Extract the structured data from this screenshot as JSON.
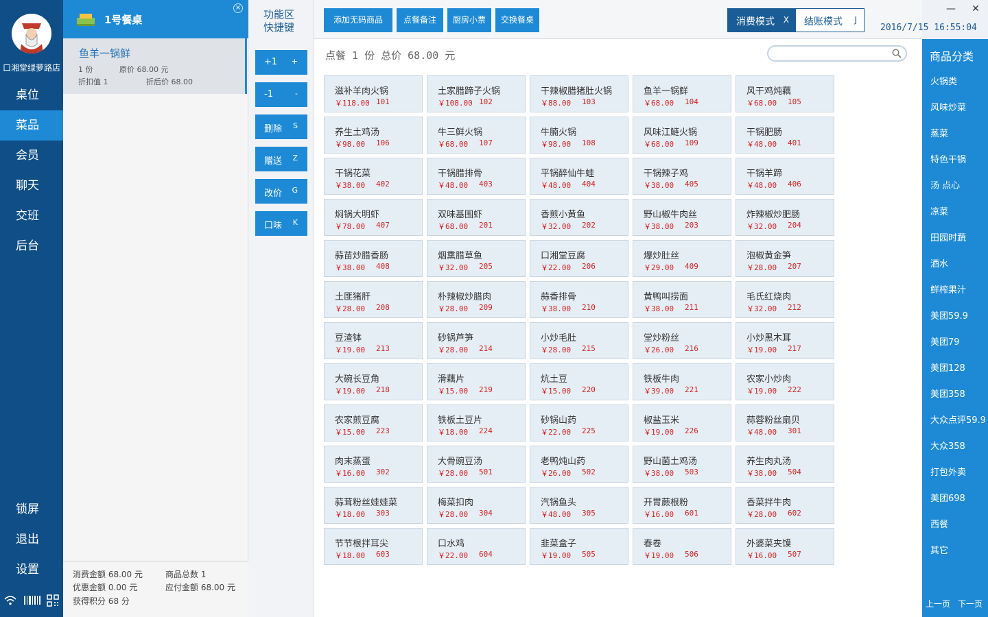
{
  "store_name": "口湘堂绿萝路店",
  "nav": [
    {
      "label": "桌位",
      "active": false
    },
    {
      "label": "菜品",
      "active": true
    },
    {
      "label": "会员",
      "active": false
    },
    {
      "label": "聊天",
      "active": false
    },
    {
      "label": "交班",
      "active": false
    },
    {
      "label": "后台",
      "active": false
    }
  ],
  "nav_bottom": [
    {
      "label": "锁屏"
    },
    {
      "label": "退出"
    },
    {
      "label": "设置"
    }
  ],
  "table": {
    "title": "1号餐桌",
    "close_icon": "close-icon"
  },
  "order_item": {
    "name": "鱼羊一锅鲜",
    "qty": "1 份",
    "original_price": "原价 68.00 元",
    "discount": "折扣值 1",
    "discounted_price": "折后价 68.00"
  },
  "summary": {
    "consume_amount": "消费金额 68.00 元",
    "goods_total": "商品总数 1",
    "discount_amount": "优惠金额 0.00 元",
    "payable": "应付金额 68.00 元",
    "points": "获得积分 68 分"
  },
  "func": {
    "title_line1": "功能区",
    "title_line2": "快捷键",
    "buttons": [
      {
        "label": "+1",
        "key": "+"
      },
      {
        "label": "-1",
        "key": "-"
      },
      {
        "label": "删除",
        "key": "S"
      },
      {
        "label": "赠送",
        "key": "Z"
      },
      {
        "label": "改价",
        "key": "G"
      },
      {
        "label": "口味",
        "key": "K"
      }
    ]
  },
  "toolbar": {
    "buttons": [
      "添加无码商品",
      "点餐备注",
      "厨房小票",
      "交换餐桌"
    ],
    "mode_consume": "消费模式",
    "mode_consume_key": "X",
    "mode_checkout": "结账模式",
    "mode_checkout_key": "J",
    "datetime": "2016/7/15 16:55:04",
    "minimize": "—",
    "close": "✕"
  },
  "order_summary": "点餐 1 份 总价 68.00 元",
  "search": {
    "placeholder": "",
    "value": ""
  },
  "products": [
    {
      "name": "滋补羊肉火锅",
      "price": "￥118.00",
      "code": "101"
    },
    {
      "name": "土家腊蹄子火锅",
      "price": "￥108.00",
      "code": "102"
    },
    {
      "name": "干辣椒腊猪肚火锅",
      "price": "￥88.00",
      "code": "103"
    },
    {
      "name": "鱼羊一锅鲜",
      "price": "￥68.00",
      "code": "104"
    },
    {
      "name": "风干鸡炖藕",
      "price": "￥68.00",
      "code": "105"
    },
    {
      "name": "养生土鸡汤",
      "price": "￥98.00",
      "code": "106"
    },
    {
      "name": "牛三鲜火锅",
      "price": "￥68.00",
      "code": "107"
    },
    {
      "name": "牛腩火锅",
      "price": "￥98.00",
      "code": "108"
    },
    {
      "name": "风味江鲢火锅",
      "price": "￥68.00",
      "code": "109"
    },
    {
      "name": "干锅肥肠",
      "price": "￥48.00",
      "code": "401"
    },
    {
      "name": "干锅花菜",
      "price": "￥38.00",
      "code": "402"
    },
    {
      "name": "干锅腊排骨",
      "price": "￥48.00",
      "code": "403"
    },
    {
      "name": "平锅醉仙牛蛙",
      "price": "￥48.00",
      "code": "404"
    },
    {
      "name": "干锅辣子鸡",
      "price": "￥38.00",
      "code": "405"
    },
    {
      "name": "干锅羊蹄",
      "price": "￥48.00",
      "code": "406"
    },
    {
      "name": "焖锅大明虾",
      "price": "￥78.00",
      "code": "407"
    },
    {
      "name": "双味基围虾",
      "price": "￥68.00",
      "code": "201"
    },
    {
      "name": "香煎小黄鱼",
      "price": "￥32.00",
      "code": "202"
    },
    {
      "name": "野山椒牛肉丝",
      "price": "￥38.00",
      "code": "203"
    },
    {
      "name": "炸辣椒炒肥肠",
      "price": "￥32.00",
      "code": "204"
    },
    {
      "name": "蒜苗炒腊香肠",
      "price": "￥38.00",
      "code": "408"
    },
    {
      "name": "烟熏腊草鱼",
      "price": "￥32.00",
      "code": "205"
    },
    {
      "name": "口湘堂豆腐",
      "price": "￥22.00",
      "code": "206"
    },
    {
      "name": "爆炒肚丝",
      "price": "￥29.00",
      "code": "409"
    },
    {
      "name": "泡椒黄金笋",
      "price": "￥28.00",
      "code": "207"
    },
    {
      "name": "土匪猪肝",
      "price": "￥28.00",
      "code": "208"
    },
    {
      "name": "朴辣椒炒腊肉",
      "price": "￥28.00",
      "code": "209"
    },
    {
      "name": "蒜香排骨",
      "price": "￥38.00",
      "code": "210"
    },
    {
      "name": "黄鸭叫捞面",
      "price": "￥38.00",
      "code": "211"
    },
    {
      "name": "毛氏红烧肉",
      "price": "￥32.00",
      "code": "212"
    },
    {
      "name": "豆渣钵",
      "price": "￥19.00",
      "code": "213"
    },
    {
      "name": "砂锅芦笋",
      "price": "￥28.00",
      "code": "214"
    },
    {
      "name": "小炒毛肚",
      "price": "￥28.00",
      "code": "215"
    },
    {
      "name": "堂炒粉丝",
      "price": "￥26.00",
      "code": "216"
    },
    {
      "name": "小炒黑木耳",
      "price": "￥19.00",
      "code": "217"
    },
    {
      "name": "大碗长豆角",
      "price": "￥19.00",
      "code": "218"
    },
    {
      "name": "滑藕片",
      "price": "￥15.00",
      "code": "219"
    },
    {
      "name": "炕土豆",
      "price": "￥15.00",
      "code": "220"
    },
    {
      "name": "铁板牛肉",
      "price": "￥39.00",
      "code": "221"
    },
    {
      "name": "农家小炒肉",
      "price": "￥19.00",
      "code": "222"
    },
    {
      "name": "农家煎豆腐",
      "price": "￥15.00",
      "code": "223"
    },
    {
      "name": "铁板土豆片",
      "price": "￥18.00",
      "code": "224"
    },
    {
      "name": "砂锅山药",
      "price": "￥22.00",
      "code": "225"
    },
    {
      "name": "椒盐玉米",
      "price": "￥19.00",
      "code": "226"
    },
    {
      "name": "蒜蓉粉丝扇贝",
      "price": "￥48.00",
      "code": "301"
    },
    {
      "name": "肉末蒸蛋",
      "price": "￥16.00",
      "code": "302"
    },
    {
      "name": "大骨豌豆汤",
      "price": "￥28.00",
      "code": "501"
    },
    {
      "name": "老鸭炖山药",
      "price": "￥26.00",
      "code": "502"
    },
    {
      "name": "野山菌土鸡汤",
      "price": "￥38.00",
      "code": "503"
    },
    {
      "name": "养生肉丸汤",
      "price": "￥38.00",
      "code": "504"
    },
    {
      "name": "蒜茸粉丝娃娃菜",
      "price": "￥18.00",
      "code": "303"
    },
    {
      "name": "梅菜扣肉",
      "price": "￥28.00",
      "code": "304"
    },
    {
      "name": "汽锅鱼头",
      "price": "￥48.00",
      "code": "305"
    },
    {
      "name": "开胃蕨根粉",
      "price": "￥16.00",
      "code": "601"
    },
    {
      "name": "香菜拌牛肉",
      "price": "￥28.00",
      "code": "602"
    },
    {
      "name": "节节根拌耳尖",
      "price": "￥18.00",
      "code": "603"
    },
    {
      "name": "口水鸡",
      "price": "￥22.00",
      "code": "604"
    },
    {
      "name": "韭菜盒子",
      "price": "￥19.00",
      "code": "505"
    },
    {
      "name": "春卷",
      "price": "￥19.00",
      "code": "506"
    },
    {
      "name": "外婆菜夹馍",
      "price": "￥16.00",
      "code": "507"
    }
  ],
  "categories": {
    "title": "商品分类",
    "items": [
      "火锅类",
      "风味炒菜",
      "蒸菜",
      "特色干锅",
      "汤 点心",
      "凉菜",
      "田园时蔬",
      "酒水",
      "鲜榨果汁",
      "美团59.9",
      "美团79",
      "美团128",
      "美团358",
      "大众点评59.9",
      "大众358",
      "打包外卖",
      "美团698",
      "西餐",
      "其它"
    ],
    "prev": "上一页",
    "next": "下一页"
  },
  "colors": {
    "nav_bg": "#0f4e86",
    "accent": "#1e8ad6",
    "price_red": "#d52222",
    "mode_dark": "#1a5c95"
  }
}
